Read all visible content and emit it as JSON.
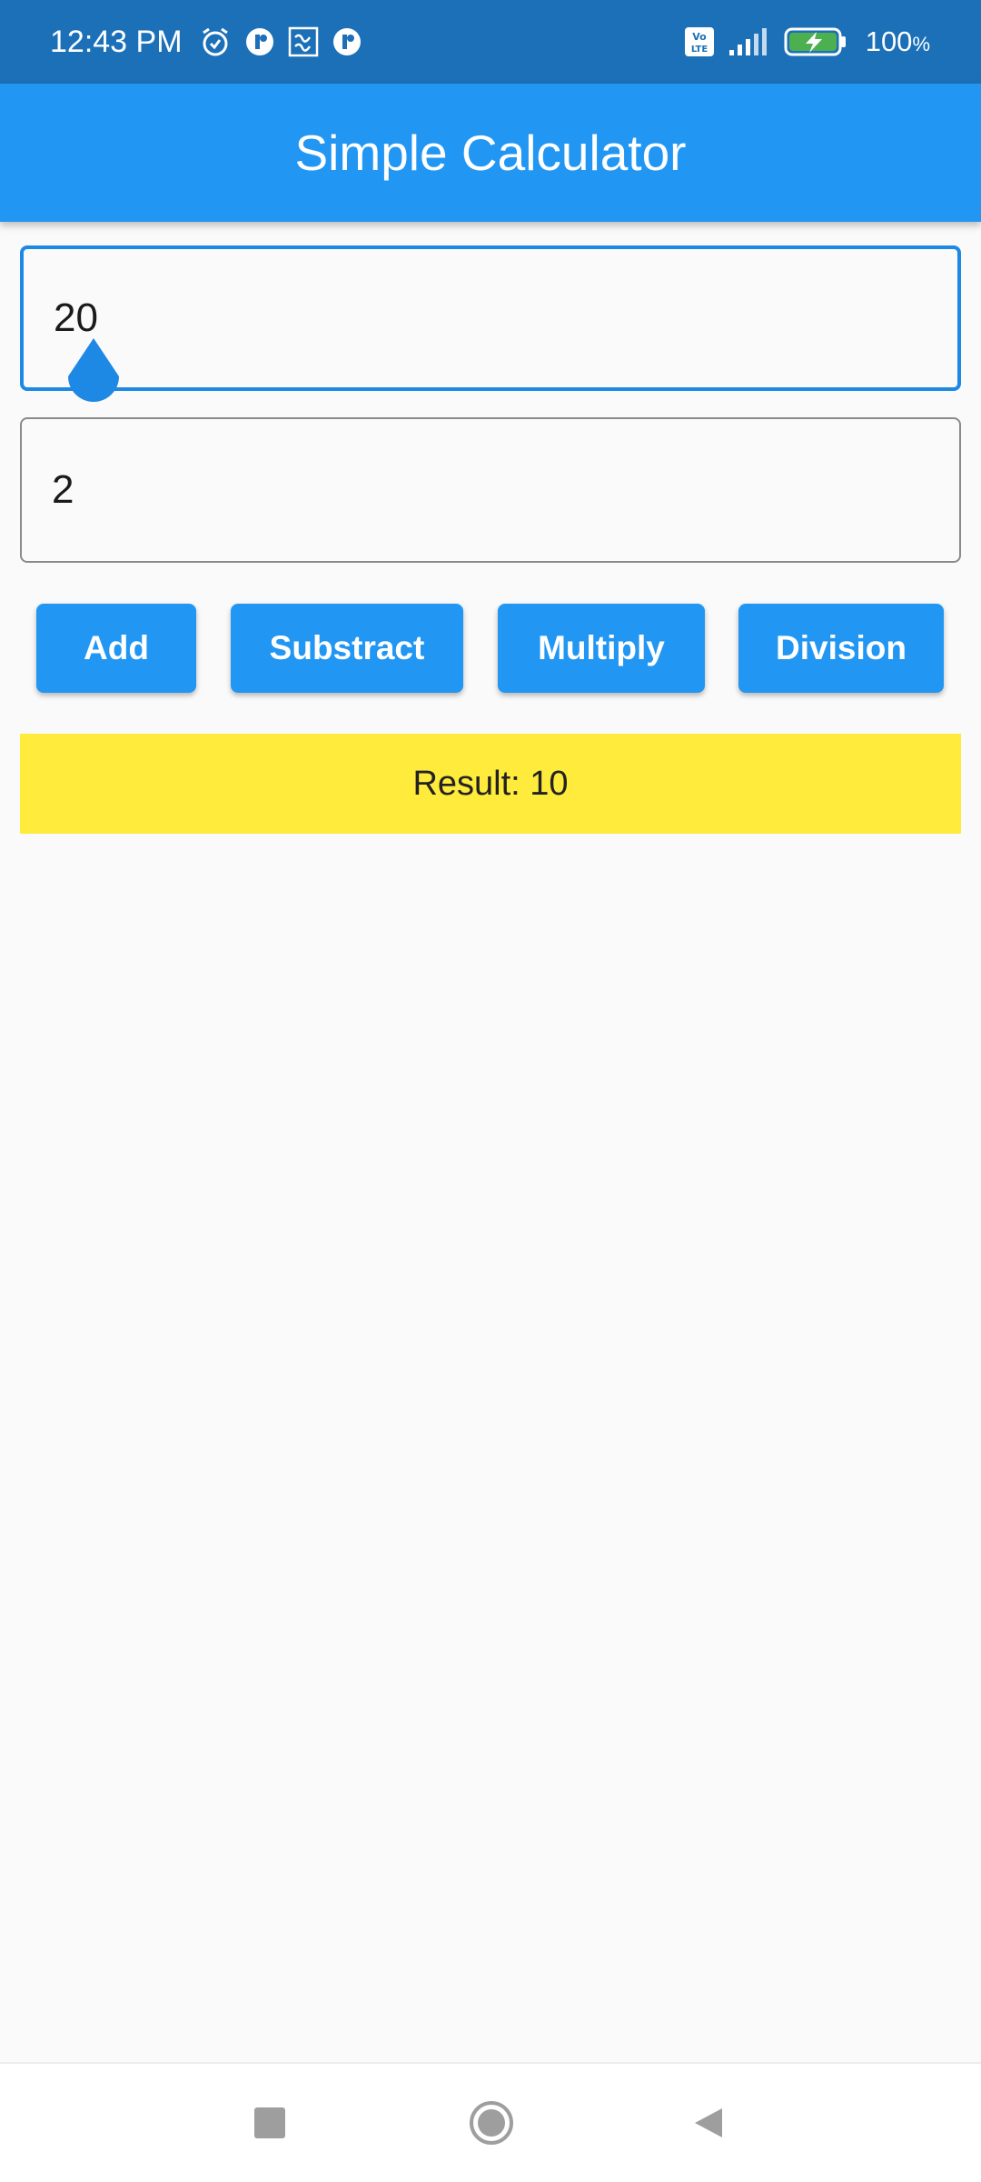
{
  "status_bar": {
    "time": "12:43 PM",
    "battery_percent": "100",
    "battery_unit": "%",
    "icons_left": [
      "alarm-icon",
      "app-notification-icon",
      "sim-notification-icon",
      "app-notification-icon"
    ],
    "icons_right": [
      "volte-icon",
      "signal-icon",
      "battery-charging-icon"
    ]
  },
  "app_bar": {
    "title": "Simple Calculator",
    "color": "#2196f3"
  },
  "inputs": {
    "first_value": "20",
    "second_value": "2"
  },
  "buttons": {
    "add": "Add",
    "subtract": "Substract",
    "multiply": "Multiply",
    "division": "Division"
  },
  "result": {
    "text": "Result: 10",
    "background": "#ffeb3b"
  },
  "nav_bar": {
    "icons": [
      "recent-apps-icon",
      "home-icon",
      "back-icon"
    ]
  }
}
